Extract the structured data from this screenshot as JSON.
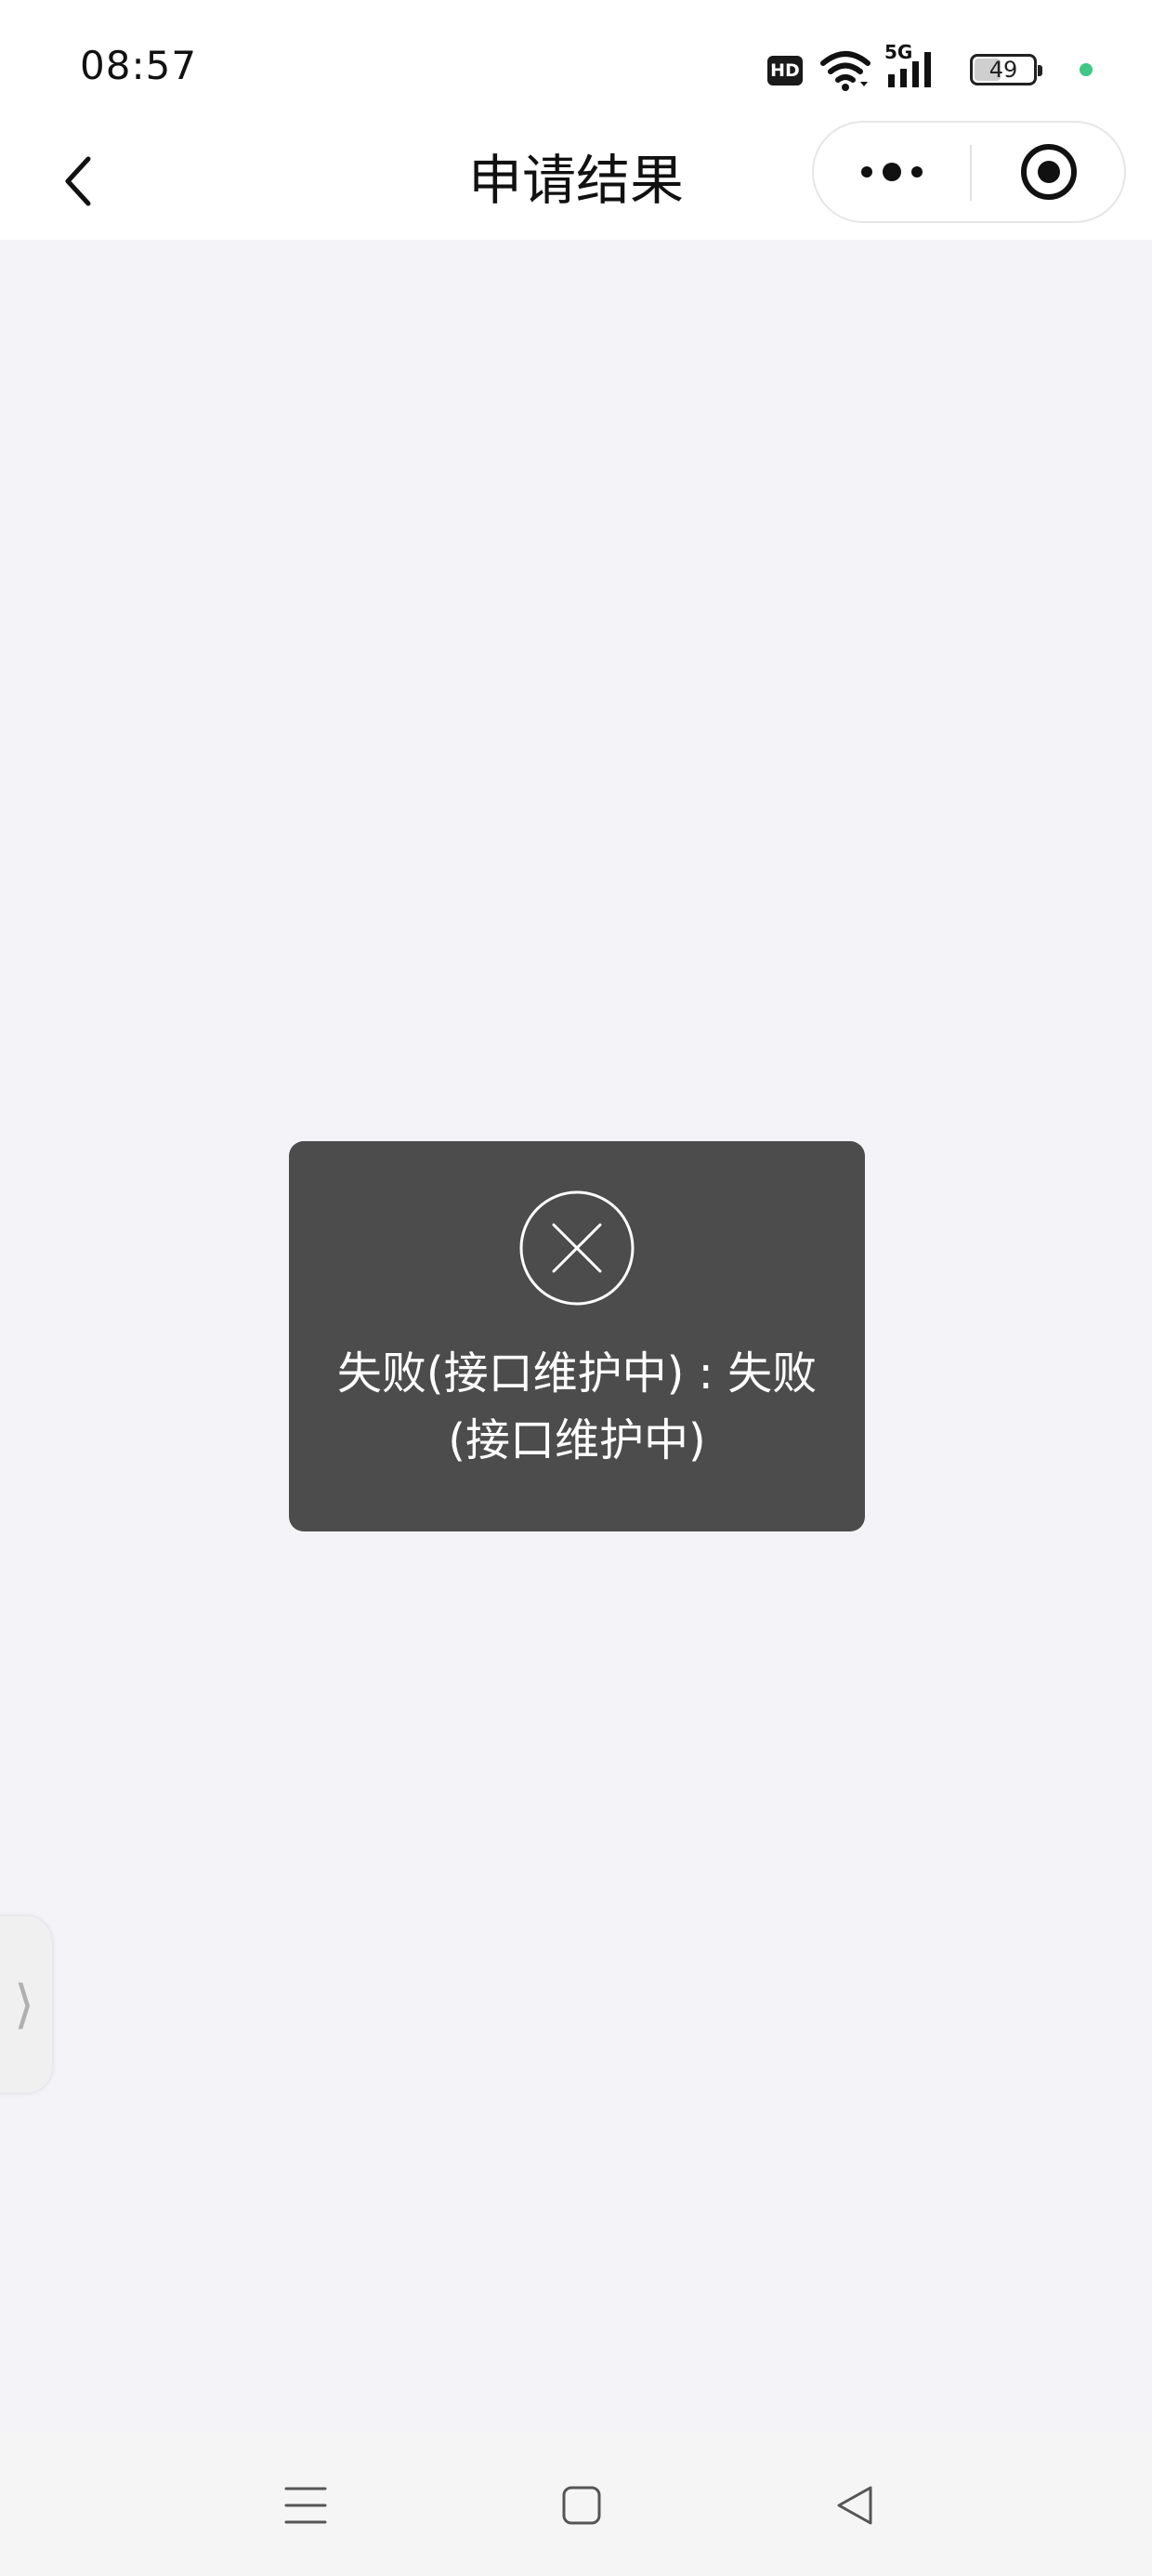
{
  "status_bar": {
    "time": "08:57",
    "hd_label": "HD",
    "network_label": "5G",
    "battery_level": 49,
    "battery_text": "49"
  },
  "nav": {
    "title": "申请结果",
    "back_icon": "chevron-left-icon",
    "more_icon": "more-dots-icon",
    "close_icon": "target-circle-icon"
  },
  "toast": {
    "icon": "close-circle-icon",
    "message": "失败(接口维护中) : 失败(接口维护中)"
  },
  "side_tab": {
    "label": "⟩"
  },
  "bottom_nav": {
    "menu_icon": "menu-icon",
    "home_icon": "home-square-icon",
    "back_icon": "back-triangle-icon"
  },
  "colors": {
    "page_bg": "#f4f4f8",
    "toast_bg": "#4c4c4c",
    "accent_dot": "#3ec785"
  }
}
